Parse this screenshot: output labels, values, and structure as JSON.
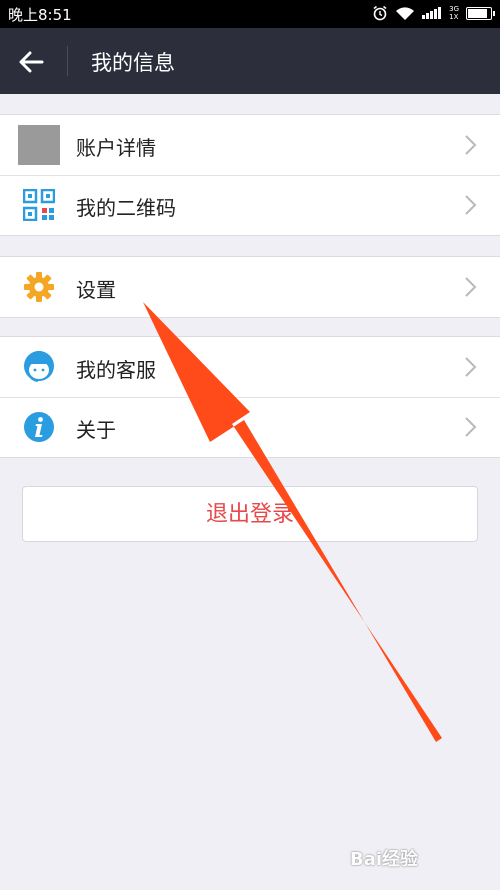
{
  "status_bar": {
    "time": "晚上8:51",
    "network_top": "3G",
    "network_bottom": "1X",
    "battery_fraction": 0.92
  },
  "header": {
    "title": "我的信息",
    "back_icon": "arrow-left-icon"
  },
  "sections": [
    {
      "items": [
        {
          "label": "账户详情",
          "icon": "avatar-placeholder"
        },
        {
          "label": "我的二维码",
          "icon": "qr-code-icon"
        }
      ]
    },
    {
      "items": [
        {
          "label": "设置",
          "icon": "gear-icon"
        }
      ]
    },
    {
      "items": [
        {
          "label": "我的客服",
          "icon": "customer-service-icon"
        },
        {
          "label": "关于",
          "icon": "info-icon"
        }
      ]
    }
  ],
  "logout_label": "退出登录",
  "watermark": "Bai经验",
  "colors": {
    "header_bg": "#2c2e3b",
    "page_bg": "#f0eff5",
    "logout_text": "#e8484a",
    "gear": "#f5a623",
    "info": "#2a9ce0",
    "overlay_arrow": "#ff4a1a"
  }
}
